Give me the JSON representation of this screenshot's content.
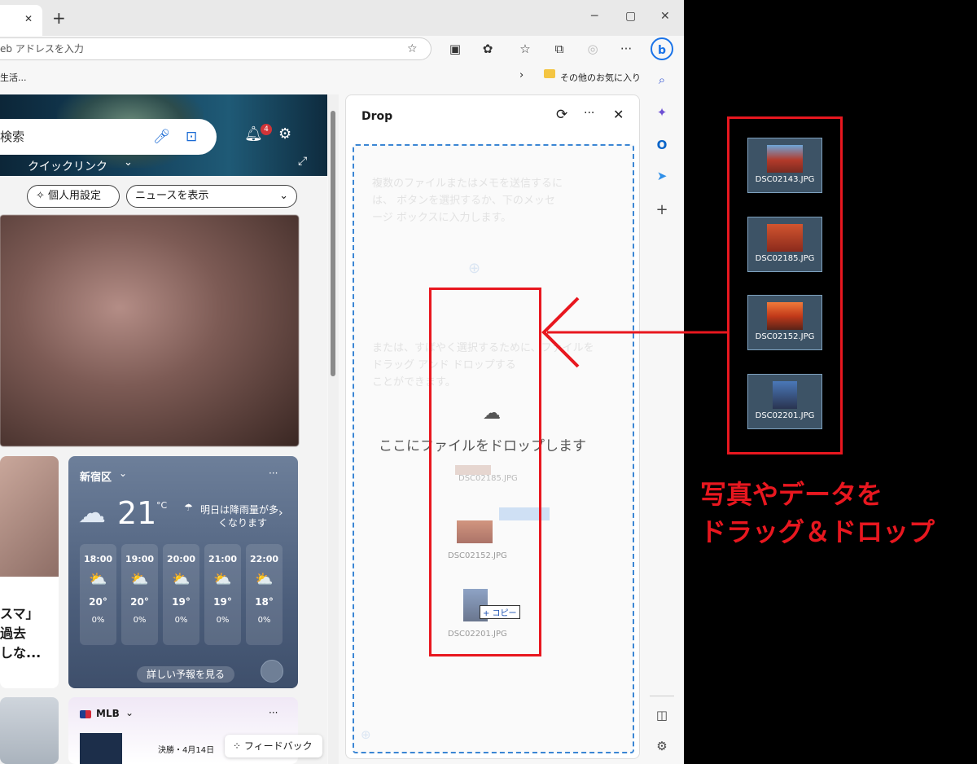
{
  "browser": {
    "address_placeholder": "eb アドレスを入力",
    "favorites_left": "生活...",
    "favorites_folder": "その他のお気に入り",
    "new_tab": "+",
    "tab_close": "✕"
  },
  "news": {
    "search_placeholder": "検索",
    "quick_links": "クイックリンク",
    "notification_count": "4",
    "personalize": "個人用設定",
    "show_news": "ニュースを表示",
    "article_text": [
      "スマ」",
      "過去",
      "しな..."
    ],
    "feedback": "フィードバック"
  },
  "weather": {
    "location": "新宿区",
    "temp": "21",
    "unit": "°C",
    "note_line1": "明日は降雨量が多",
    "note_line2": "くなります",
    "hours": [
      {
        "time": "18:00",
        "temp": "20°",
        "precip": "0%"
      },
      {
        "time": "19:00",
        "temp": "20°",
        "precip": "0%"
      },
      {
        "time": "20:00",
        "temp": "19°",
        "precip": "0%"
      },
      {
        "time": "21:00",
        "temp": "19°",
        "precip": "0%"
      },
      {
        "time": "22:00",
        "temp": "18°",
        "precip": "0%"
      }
    ],
    "details": "詳しい予報を見る",
    "more": "···"
  },
  "mlb": {
    "title": "MLB",
    "sub": "決勝・4月14日",
    "more": "···"
  },
  "drop": {
    "title": "Drop",
    "ghost_text1": [
      "複数のファイルまたはメモを送信するに",
      "は、 ボタンを選択するか、下のメッセ",
      "ージ ボックスに入力します。"
    ],
    "ghost_text2": [
      "または、すばやく選択するために、ファイルをドラッグ アンド ドロップする",
      "ことができます。"
    ],
    "drop_message": "ここにファイルをドロップします",
    "ghost_files": [
      "DSC02185.JPG",
      "DSC02152.JPG",
      "DSC02201.JPG"
    ],
    "copy_badge": "+ コピー"
  },
  "desktop_files": [
    {
      "name": "DSC02143.JPG"
    },
    {
      "name": "DSC02185.JPG"
    },
    {
      "name": "DSC02152.JPG"
    },
    {
      "name": "DSC02201.JPG"
    }
  ],
  "annotation": {
    "line1": "写真やデータを",
    "line2": "ドラッグ＆ドロップ",
    "color": "#e8171f"
  }
}
